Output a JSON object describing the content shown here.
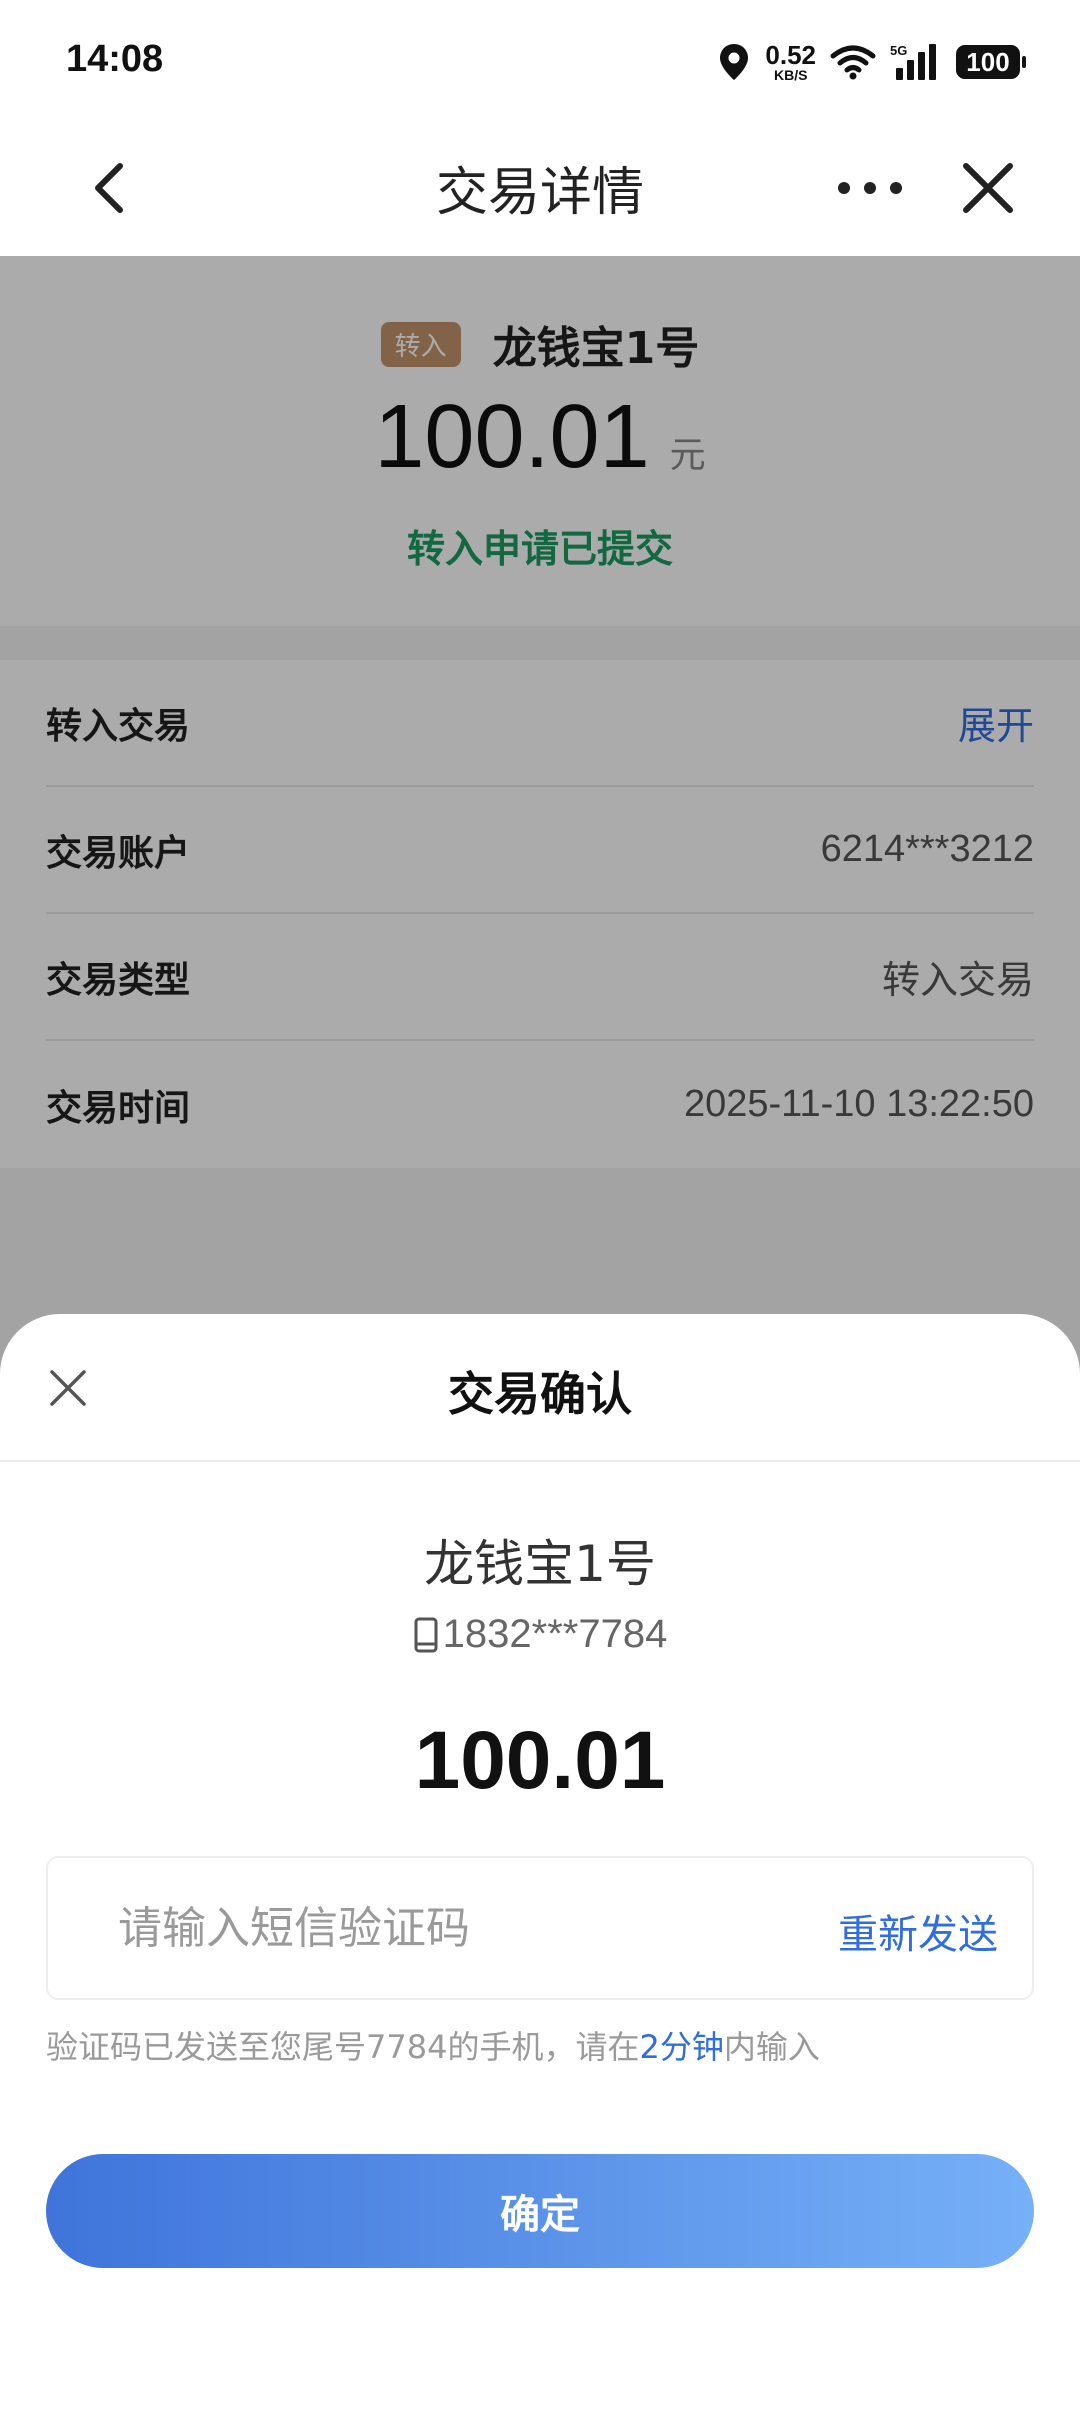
{
  "status_bar": {
    "time": "14:08",
    "net_speed_value": "0.52",
    "net_speed_unit": "KB/S",
    "network_type": "5G",
    "battery": "100"
  },
  "nav": {
    "title": "交易详情"
  },
  "summary": {
    "tag": "转入",
    "product": "龙钱宝1号",
    "amount": "100.01",
    "unit": "元",
    "status": "转入申请已提交"
  },
  "details": [
    {
      "label": "转入交易",
      "value": "展开"
    },
    {
      "label": "交易账户",
      "value": "6214***3212"
    },
    {
      "label": "交易类型",
      "value": "转入交易"
    },
    {
      "label": "交易时间",
      "value": "2025-11-10 13:22:50"
    }
  ],
  "sheet": {
    "title": "交易确认",
    "product": "龙钱宝1号",
    "phone": "1832***7784",
    "amount": "100.01",
    "code_placeholder": "请输入短信验证码",
    "resend": "重新发送",
    "hint_prefix": "验证码已发送至您尾号7784的手机，请在",
    "hint_highlight": "2分钟",
    "hint_suffix": "内输入",
    "confirm": "确定"
  },
  "colors": {
    "accent_blue": "#2f6de0",
    "status_green": "#1a9b62",
    "tag_brown": "#c2946a",
    "button_gradient_start": "#3f74da",
    "button_gradient_end": "#76b0f7"
  }
}
